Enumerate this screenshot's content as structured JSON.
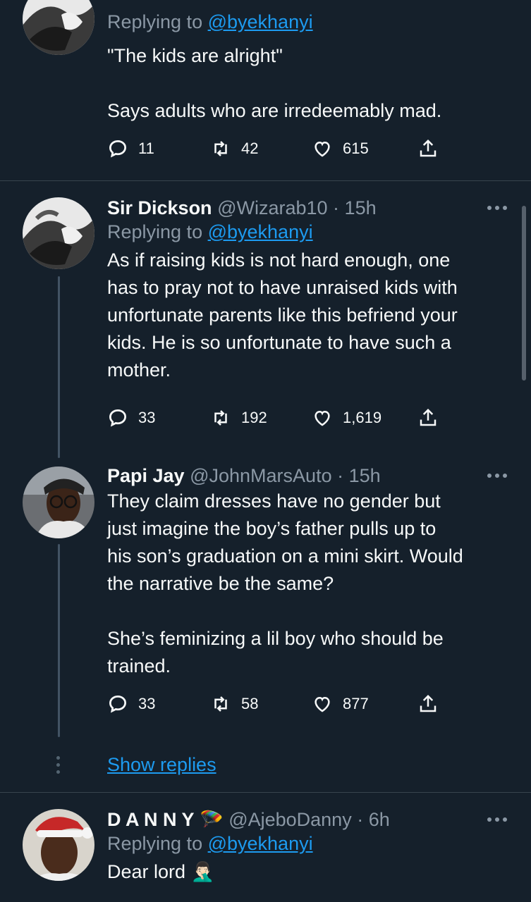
{
  "tweet1": {
    "replying_prefix": "Replying to ",
    "replying_handle": "@byekhanyi",
    "lines": [
      "\"The kids are alright\"",
      "",
      "Says adults who are irredeemably mad."
    ],
    "actions": {
      "replies": "11",
      "retweets": "42",
      "likes": "615"
    }
  },
  "tweet2": {
    "name": "Sir Dickson",
    "handle": "@Wizarab10",
    "separator": " · ",
    "time": "15h",
    "replying_prefix": "Replying to ",
    "replying_handle": "@byekhanyi",
    "lines": [
      "As if raising kids is not hard enough, one",
      "has to pray not to have unraised kids with",
      "unfortunate parents like this befriend your",
      "kids. He is so unfortunate to have such a",
      "mother."
    ],
    "actions": {
      "replies": "33",
      "retweets": "192",
      "likes": "1,619"
    }
  },
  "tweet3": {
    "name": "Papi Jay",
    "handle": "@JohnMarsAuto",
    "separator": " · ",
    "time": "15h",
    "lines": [
      "They claim dresses have no gender but",
      "just imagine the boy’s father pulls up to",
      "his son’s graduation on a mini skirt. Would",
      "the narrative be the same?",
      "",
      "She’s feminizing a lil boy who should be",
      "trained."
    ],
    "actions": {
      "replies": "33",
      "retweets": "58",
      "likes": "877"
    }
  },
  "show_replies": "Show replies",
  "tweet4": {
    "name": "D A N N Y",
    "name_emoji": "🪂",
    "handle": "@AjeboDanny",
    "separator": " · ",
    "time": "6h",
    "replying_prefix": "Replying to ",
    "replying_handle": "@byekhanyi",
    "lines": [
      "Dear lord 🤦🏻‍♂️"
    ]
  },
  "colors": {
    "background": "#15202b",
    "text": "#f7f9f9",
    "muted": "#8b98a5",
    "link": "#1d9bf0",
    "divider": "#38444d"
  },
  "icons": [
    "reply-icon",
    "retweet-icon",
    "like-icon",
    "share-icon",
    "more-icon"
  ]
}
